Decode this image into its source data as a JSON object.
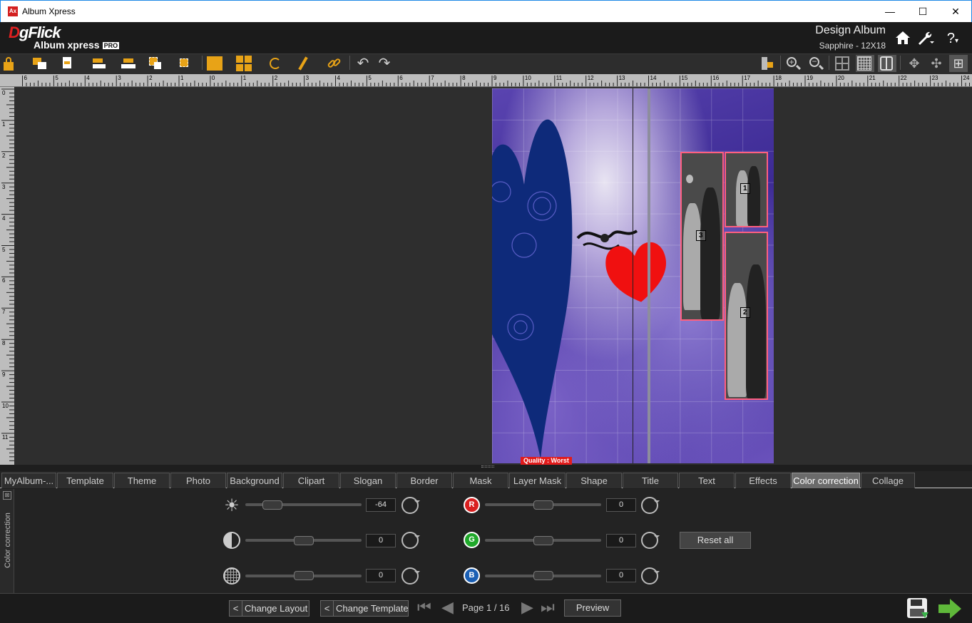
{
  "window": {
    "title": "Album Xpress",
    "app_icon": "Ax",
    "minimize": "—",
    "maximize": "☐",
    "close": "✕"
  },
  "header": {
    "logo_main": "gFlick",
    "logo_d": "D",
    "logo_sub": "Album xpress",
    "logo_badge": "PRO",
    "design_label": "Design Album",
    "album_name": "Sapphire - 12X18",
    "icons": [
      "home-icon",
      "wrench-icon",
      "help-icon"
    ],
    "help_glyph": "?"
  },
  "ruler_top": [
    "6",
    "5",
    "4",
    "3",
    "2",
    "1",
    "0",
    "1",
    "2",
    "3",
    "4",
    "5",
    "6",
    "7",
    "8",
    "9",
    "10",
    "11",
    "12",
    "13",
    "14",
    "15",
    "16",
    "17",
    "18",
    "19",
    "20",
    "21",
    "22",
    "23",
    "24"
  ],
  "ruler_left": [
    "0",
    "1",
    "2",
    "3",
    "4",
    "5",
    "6",
    "7",
    "8",
    "9",
    "10",
    "11"
  ],
  "page": {
    "quality_label": "Quality : Worst",
    "photo_numbers": [
      "1",
      "2",
      "3"
    ]
  },
  "tabs": [
    "MyAlbum-...",
    "Template",
    "Theme",
    "Photo",
    "Background",
    "Clipart",
    "Slogan",
    "Border",
    "Mask",
    "Layer Mask",
    "Shape",
    "Title",
    "Text",
    "Effects",
    "Color correction",
    "Collage"
  ],
  "active_tab": "Color correction",
  "color_correction": {
    "side_label": "Color correction",
    "brightness": {
      "icon": "brightness-icon",
      "value": "-64"
    },
    "contrast": {
      "icon": "contrast-icon",
      "value": "0"
    },
    "saturation": {
      "icon": "saturation-icon",
      "value": "0"
    },
    "red": {
      "label": "R",
      "value": "0",
      "color": "#d92020"
    },
    "green": {
      "label": "G",
      "value": "0",
      "color": "#1fa82a"
    },
    "blue": {
      "label": "B",
      "value": "0",
      "color": "#1a5fb4"
    },
    "reset_all": "Reset all"
  },
  "bottom": {
    "back_glyph": "<",
    "change_layout": "Change Layout",
    "change_template": "Change Template",
    "page_label": "Page 1 / 16",
    "preview": "Preview"
  }
}
